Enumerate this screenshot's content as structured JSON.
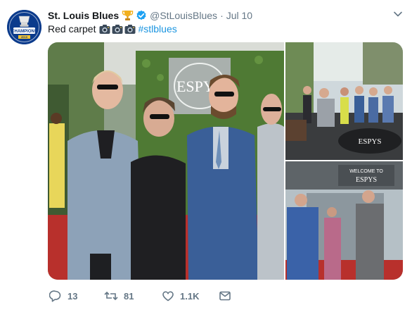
{
  "tweet": {
    "display_name": "St. Louis Blues",
    "handle": "@StLouisBlues",
    "separator": "·",
    "date": "Jul 10",
    "text": "Red carpet",
    "hashtag": "#stlblues"
  },
  "avatar": {
    "badge_text": "CHAMPIONS",
    "year_text": "2019"
  },
  "media": {
    "backdrop_logo": "ESPYS",
    "step_repeat_text": "ESPYS",
    "lounge_floor_text": "ESPYS",
    "welcome_sign": "WELCOME TO",
    "welcome_sign_logo": "ESPYS"
  },
  "actions": {
    "replies": "13",
    "retweets": "81",
    "likes": "1.1K"
  },
  "colors": {
    "link": "#1b95e0",
    "muted": "#657786",
    "verified": "#1da1f2",
    "avatar_bg": "#0b3b8c",
    "carpet": "#b8302c"
  },
  "icons": [
    "chevron-down-icon",
    "trophy-icon",
    "verified-badge-icon",
    "camera-icon",
    "reply-icon",
    "retweet-icon",
    "like-icon",
    "direct-message-icon"
  ]
}
